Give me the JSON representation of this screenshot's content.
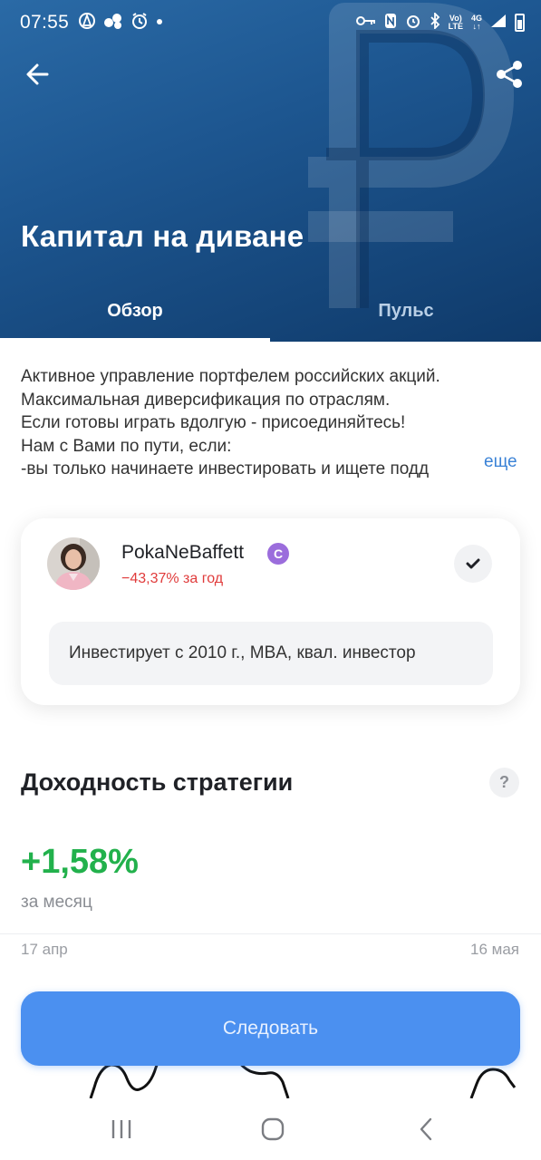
{
  "status_bar": {
    "time": "07:55",
    "net_top": "Vo)\nLTE",
    "net_gen": "4G",
    "icons_left": [
      "vpn-icon",
      "apps-icon",
      "alarm-icon",
      "dot-icon"
    ],
    "icons_right": [
      "key-icon",
      "nfc-icon",
      "alarm-icon",
      "bluetooth-icon",
      "volte-icon",
      "4g-icon",
      "signal-icon",
      "battery-icon"
    ]
  },
  "header": {
    "title": "Капитал на диване",
    "back_icon": "arrow-left-icon",
    "share_icon": "share-icon",
    "background_accent": "#1d5690"
  },
  "tabs": [
    {
      "label": "Обзор",
      "active": true
    },
    {
      "label": "Пульс",
      "active": false
    }
  ],
  "description": {
    "lines": [
      "Активное управление портфелем российских акций.",
      "Максимальная диверсификация по отраслям.",
      "Если готовы играть вдолгую - присоединяйтесь!",
      "Нам с Вами по пути, если:",
      "-вы только начинаете инвестировать  и ищете подд"
    ],
    "more_label": "еще"
  },
  "author": {
    "name": "PokaNeBaffett",
    "badge": "C",
    "yield": "−43,37% за год",
    "bio": "Инвестирует с 2010 г., MBA, квал. инвестор",
    "yield_color": "#e03b3b",
    "badge_color": "#9b6ddc"
  },
  "strategy": {
    "title": "Доходность стратегии",
    "help_label": "?",
    "yield_value": "+1,58%",
    "yield_period": "за месяц",
    "date_start": "17 апр",
    "date_end": "16 мая",
    "positive_color": "#22b14c"
  },
  "follow_button": {
    "label": "Следовать",
    "color": "#4b90f0"
  },
  "nav_bar": {
    "icons": [
      "recent-apps-icon",
      "home-icon",
      "back-icon"
    ]
  }
}
